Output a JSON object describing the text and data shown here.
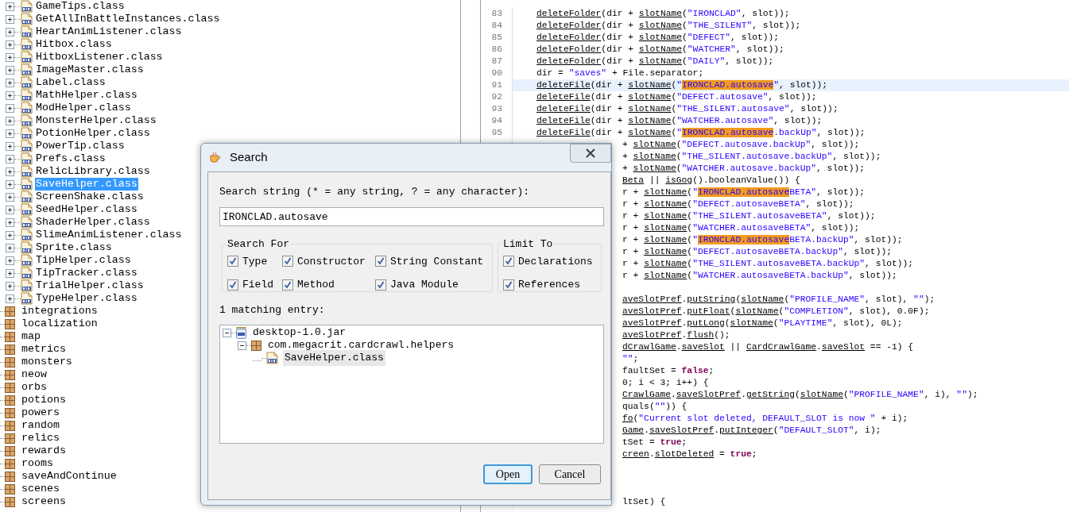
{
  "package_tree": {
    "items": [
      {
        "label": "GameTips.class",
        "kind": "class",
        "selected": false
      },
      {
        "label": "GetAllInBattleInstances.class",
        "kind": "class",
        "selected": false
      },
      {
        "label": "HeartAnimListener.class",
        "kind": "class",
        "selected": false
      },
      {
        "label": "Hitbox.class",
        "kind": "class",
        "selected": false
      },
      {
        "label": "HitboxListener.class",
        "kind": "class",
        "selected": false
      },
      {
        "label": "ImageMaster.class",
        "kind": "class",
        "selected": false
      },
      {
        "label": "Label.class",
        "kind": "class",
        "selected": false
      },
      {
        "label": "MathHelper.class",
        "kind": "class",
        "selected": false
      },
      {
        "label": "ModHelper.class",
        "kind": "class",
        "selected": false
      },
      {
        "label": "MonsterHelper.class",
        "kind": "class",
        "selected": false
      },
      {
        "label": "PotionHelper.class",
        "kind": "class",
        "selected": false
      },
      {
        "label": "PowerTip.class",
        "kind": "class",
        "selected": false
      },
      {
        "label": "Prefs.class",
        "kind": "class",
        "selected": false
      },
      {
        "label": "RelicLibrary.class",
        "kind": "class",
        "selected": false
      },
      {
        "label": "SaveHelper.class",
        "kind": "class",
        "selected": true
      },
      {
        "label": "ScreenShake.class",
        "kind": "class",
        "selected": false
      },
      {
        "label": "SeedHelper.class",
        "kind": "class",
        "selected": false
      },
      {
        "label": "ShaderHelper.class",
        "kind": "class",
        "selected": false
      },
      {
        "label": "SlimeAnimListener.class",
        "kind": "class",
        "selected": false
      },
      {
        "label": "Sprite.class",
        "kind": "class",
        "selected": false
      },
      {
        "label": "TipHelper.class",
        "kind": "class",
        "selected": false
      },
      {
        "label": "TipTracker.class",
        "kind": "class",
        "selected": false
      },
      {
        "label": "TrialHelper.class",
        "kind": "class",
        "selected": false
      },
      {
        "label": "TypeHelper.class",
        "kind": "class",
        "selected": false
      },
      {
        "label": "integrations",
        "kind": "package",
        "selected": false
      },
      {
        "label": "localization",
        "kind": "package",
        "selected": false
      },
      {
        "label": "map",
        "kind": "package",
        "selected": false
      },
      {
        "label": "metrics",
        "kind": "package",
        "selected": false
      },
      {
        "label": "monsters",
        "kind": "package",
        "selected": false
      },
      {
        "label": "neow",
        "kind": "package",
        "selected": false
      },
      {
        "label": "orbs",
        "kind": "package",
        "selected": false
      },
      {
        "label": "potions",
        "kind": "package",
        "selected": false
      },
      {
        "label": "powers",
        "kind": "package",
        "selected": false
      },
      {
        "label": "random",
        "kind": "package",
        "selected": false
      },
      {
        "label": "relics",
        "kind": "package",
        "selected": false
      },
      {
        "label": "rewards",
        "kind": "package",
        "selected": false
      },
      {
        "label": "rooms",
        "kind": "package",
        "selected": false
      },
      {
        "label": "saveAndContinue",
        "kind": "package",
        "selected": false
      },
      {
        "label": "scenes",
        "kind": "package",
        "selected": false
      },
      {
        "label": "screens",
        "kind": "package",
        "selected": false
      }
    ]
  },
  "editor": {
    "lines": [
      {
        "kind": "full",
        "number": "83",
        "current": false,
        "segments": [
          {
            "text": "deleteFolder",
            "kind": "call"
          },
          {
            "text": "(dir + ",
            "kind": "plain"
          },
          {
            "text": "slotName",
            "kind": "call"
          },
          {
            "text": "(",
            "kind": "plain"
          },
          {
            "text": "\"IRONCLAD\"",
            "kind": "string"
          },
          {
            "text": ", slot));",
            "kind": "plain"
          }
        ]
      },
      {
        "kind": "full",
        "number": "84",
        "current": false,
        "segments": [
          {
            "text": "deleteFolder",
            "kind": "call"
          },
          {
            "text": "(dir + ",
            "kind": "plain"
          },
          {
            "text": "slotName",
            "kind": "call"
          },
          {
            "text": "(",
            "kind": "plain"
          },
          {
            "text": "\"THE_SILENT\"",
            "kind": "string"
          },
          {
            "text": ", slot));",
            "kind": "plain"
          }
        ]
      },
      {
        "kind": "full",
        "number": "85",
        "current": false,
        "segments": [
          {
            "text": "deleteFolder",
            "kind": "call"
          },
          {
            "text": "(dir + ",
            "kind": "plain"
          },
          {
            "text": "slotName",
            "kind": "call"
          },
          {
            "text": "(",
            "kind": "plain"
          },
          {
            "text": "\"DEFECT\"",
            "kind": "string"
          },
          {
            "text": ", slot));",
            "kind": "plain"
          }
        ]
      },
      {
        "kind": "full",
        "number": "86",
        "current": false,
        "segments": [
          {
            "text": "deleteFolder",
            "kind": "call"
          },
          {
            "text": "(dir + ",
            "kind": "plain"
          },
          {
            "text": "slotName",
            "kind": "call"
          },
          {
            "text": "(",
            "kind": "plain"
          },
          {
            "text": "\"WATCHER\"",
            "kind": "string"
          },
          {
            "text": ", slot));",
            "kind": "plain"
          }
        ]
      },
      {
        "kind": "full",
        "number": "87",
        "current": false,
        "segments": [
          {
            "text": "deleteFolder",
            "kind": "call"
          },
          {
            "text": "(dir + ",
            "kind": "plain"
          },
          {
            "text": "slotName",
            "kind": "call"
          },
          {
            "text": "(",
            "kind": "plain"
          },
          {
            "text": "\"DAILY\"",
            "kind": "string"
          },
          {
            "text": ", slot));",
            "kind": "plain"
          }
        ]
      },
      {
        "kind": "full",
        "number": "90",
        "current": false,
        "segments": [
          {
            "text": "dir = ",
            "kind": "plain"
          },
          {
            "text": "\"saves\"",
            "kind": "string"
          },
          {
            "text": " + File.separator;",
            "kind": "plain"
          }
        ]
      },
      {
        "kind": "full",
        "number": "91",
        "current": true,
        "segments": [
          {
            "text": "deleteFile",
            "kind": "call"
          },
          {
            "text": "(dir + ",
            "kind": "plain"
          },
          {
            "text": "slotName",
            "kind": "call"
          },
          {
            "text": "(",
            "kind": "plain"
          },
          {
            "text": "\"",
            "kind": "string"
          },
          {
            "text": "IRONCLAD.autosave",
            "kind": "match"
          },
          {
            "text": "\"",
            "kind": "string"
          },
          {
            "text": ", slot));",
            "kind": "plain"
          }
        ]
      },
      {
        "kind": "full",
        "number": "92",
        "current": false,
        "segments": [
          {
            "text": "deleteFile",
            "kind": "call"
          },
          {
            "text": "(dir + ",
            "kind": "plain"
          },
          {
            "text": "slotName",
            "kind": "call"
          },
          {
            "text": "(",
            "kind": "plain"
          },
          {
            "text": "\"DEFECT.autosave\"",
            "kind": "string"
          },
          {
            "text": ", slot));",
            "kind": "plain"
          }
        ]
      },
      {
        "kind": "full",
        "number": "93",
        "current": false,
        "segments": [
          {
            "text": "deleteFile",
            "kind": "call"
          },
          {
            "text": "(dir + ",
            "kind": "plain"
          },
          {
            "text": "slotName",
            "kind": "call"
          },
          {
            "text": "(",
            "kind": "plain"
          },
          {
            "text": "\"THE_SILENT.autosave\"",
            "kind": "string"
          },
          {
            "text": ", slot));",
            "kind": "plain"
          }
        ]
      },
      {
        "kind": "full",
        "number": "94",
        "current": false,
        "segments": [
          {
            "text": "deleteFile",
            "kind": "call"
          },
          {
            "text": "(dir + ",
            "kind": "plain"
          },
          {
            "text": "slotName",
            "kind": "call"
          },
          {
            "text": "(",
            "kind": "plain"
          },
          {
            "text": "\"WATCHER.autosave\"",
            "kind": "string"
          },
          {
            "text": ", slot));",
            "kind": "plain"
          }
        ]
      },
      {
        "kind": "full",
        "number": "95",
        "current": false,
        "segments": [
          {
            "text": "deleteFile",
            "kind": "call"
          },
          {
            "text": "(dir + ",
            "kind": "plain"
          },
          {
            "text": "slotName",
            "kind": "call"
          },
          {
            "text": "(",
            "kind": "plain"
          },
          {
            "text": "\"",
            "kind": "string"
          },
          {
            "text": "IRONCLAD.autosave",
            "kind": "match"
          },
          {
            "text": ".backUp\"",
            "kind": "string"
          },
          {
            "text": ", slot));",
            "kind": "plain"
          }
        ]
      },
      {
        "kind": "partial",
        "current": false,
        "segments": [
          {
            "text": "+ ",
            "kind": "plain"
          },
          {
            "text": "slotName",
            "kind": "call"
          },
          {
            "text": "(",
            "kind": "plain"
          },
          {
            "text": "\"DEFECT.autosave.backUp\"",
            "kind": "string"
          },
          {
            "text": ", slot));",
            "kind": "plain"
          }
        ]
      },
      {
        "kind": "partial",
        "current": false,
        "segments": [
          {
            "text": "+ ",
            "kind": "plain"
          },
          {
            "text": "slotName",
            "kind": "call"
          },
          {
            "text": "(",
            "kind": "plain"
          },
          {
            "text": "\"THE_SILENT.autosave.backUp\"",
            "kind": "string"
          },
          {
            "text": ", slot));",
            "kind": "plain"
          }
        ]
      },
      {
        "kind": "partial",
        "current": false,
        "segments": [
          {
            "text": "+ ",
            "kind": "plain"
          },
          {
            "text": "slotName",
            "kind": "call"
          },
          {
            "text": "(",
            "kind": "plain"
          },
          {
            "text": "\"WATCHER.autosave.backUp\"",
            "kind": "string"
          },
          {
            "text": ", slot));",
            "kind": "plain"
          }
        ]
      },
      {
        "kind": "partial",
        "current": false,
        "segments": [
          {
            "text": "Beta",
            "kind": "call"
          },
          {
            "text": " || ",
            "kind": "plain"
          },
          {
            "text": "isGog",
            "kind": "call"
          },
          {
            "text": "().booleanValue()) {",
            "kind": "plain"
          }
        ]
      },
      {
        "kind": "partial",
        "current": false,
        "segments": [
          {
            "text": "r + ",
            "kind": "plain"
          },
          {
            "text": "slotName",
            "kind": "call"
          },
          {
            "text": "(",
            "kind": "plain"
          },
          {
            "text": "\"",
            "kind": "string"
          },
          {
            "text": "IRONCLAD.autosave",
            "kind": "match"
          },
          {
            "text": "BETA\"",
            "kind": "string"
          },
          {
            "text": ", slot));",
            "kind": "plain"
          }
        ]
      },
      {
        "kind": "partial",
        "current": false,
        "segments": [
          {
            "text": "r + ",
            "kind": "plain"
          },
          {
            "text": "slotName",
            "kind": "call"
          },
          {
            "text": "(",
            "kind": "plain"
          },
          {
            "text": "\"DEFECT.autosaveBETA\"",
            "kind": "string"
          },
          {
            "text": ", slot));",
            "kind": "plain"
          }
        ]
      },
      {
        "kind": "partial",
        "current": false,
        "segments": [
          {
            "text": "r + ",
            "kind": "plain"
          },
          {
            "text": "slotName",
            "kind": "call"
          },
          {
            "text": "(",
            "kind": "plain"
          },
          {
            "text": "\"THE_SILENT.autosaveBETA\"",
            "kind": "string"
          },
          {
            "text": ", slot));",
            "kind": "plain"
          }
        ]
      },
      {
        "kind": "partial",
        "current": false,
        "segments": [
          {
            "text": "r + ",
            "kind": "plain"
          },
          {
            "text": "slotName",
            "kind": "call"
          },
          {
            "text": "(",
            "kind": "plain"
          },
          {
            "text": "\"WATCHER.autosaveBETA\"",
            "kind": "string"
          },
          {
            "text": ", slot));",
            "kind": "plain"
          }
        ]
      },
      {
        "kind": "partial",
        "current": false,
        "segments": [
          {
            "text": "r + ",
            "kind": "plain"
          },
          {
            "text": "slotName",
            "kind": "call"
          },
          {
            "text": "(",
            "kind": "plain"
          },
          {
            "text": "\"",
            "kind": "string"
          },
          {
            "text": "IRONCLAD.autosave",
            "kind": "match"
          },
          {
            "text": "BETA.backUp\"",
            "kind": "string"
          },
          {
            "text": ", slot));",
            "kind": "plain"
          }
        ]
      },
      {
        "kind": "partial",
        "current": false,
        "segments": [
          {
            "text": "r + ",
            "kind": "plain"
          },
          {
            "text": "slotName",
            "kind": "call"
          },
          {
            "text": "(",
            "kind": "plain"
          },
          {
            "text": "\"DEFECT.autosaveBETA.backUp\"",
            "kind": "string"
          },
          {
            "text": ", slot));",
            "kind": "plain"
          }
        ]
      },
      {
        "kind": "partial",
        "current": false,
        "segments": [
          {
            "text": "r + ",
            "kind": "plain"
          },
          {
            "text": "slotName",
            "kind": "call"
          },
          {
            "text": "(",
            "kind": "plain"
          },
          {
            "text": "\"THE_SILENT.autosaveBETA.backUp\"",
            "kind": "string"
          },
          {
            "text": ", slot));",
            "kind": "plain"
          }
        ]
      },
      {
        "kind": "partial",
        "current": false,
        "segments": [
          {
            "text": "r + ",
            "kind": "plain"
          },
          {
            "text": "slotName",
            "kind": "call"
          },
          {
            "text": "(",
            "kind": "plain"
          },
          {
            "text": "\"WATCHER.autosaveBETA.backUp\"",
            "kind": "string"
          },
          {
            "text": ", slot));",
            "kind": "plain"
          }
        ]
      },
      {
        "kind": "blank",
        "current": false
      },
      {
        "kind": "partial",
        "current": false,
        "segments": [
          {
            "text": "aveSlotPref",
            "kind": "call"
          },
          {
            "text": ".",
            "kind": "plain"
          },
          {
            "text": "putString",
            "kind": "call"
          },
          {
            "text": "(",
            "kind": "plain"
          },
          {
            "text": "slotName",
            "kind": "call"
          },
          {
            "text": "(",
            "kind": "plain"
          },
          {
            "text": "\"PROFILE_NAME\"",
            "kind": "string"
          },
          {
            "text": ", slot), ",
            "kind": "plain"
          },
          {
            "text": "\"\"",
            "kind": "string"
          },
          {
            "text": ");",
            "kind": "plain"
          }
        ]
      },
      {
        "kind": "partial",
        "current": false,
        "segments": [
          {
            "text": "aveSlotPref",
            "kind": "call"
          },
          {
            "text": ".",
            "kind": "plain"
          },
          {
            "text": "putFloat",
            "kind": "call"
          },
          {
            "text": "(",
            "kind": "plain"
          },
          {
            "text": "slotName",
            "kind": "call"
          },
          {
            "text": "(",
            "kind": "plain"
          },
          {
            "text": "\"COMPLETION\"",
            "kind": "string"
          },
          {
            "text": ", slot), 0.0F);",
            "kind": "plain"
          }
        ]
      },
      {
        "kind": "partial",
        "current": false,
        "segments": [
          {
            "text": "aveSlotPref",
            "kind": "call"
          },
          {
            "text": ".",
            "kind": "plain"
          },
          {
            "text": "putLong",
            "kind": "call"
          },
          {
            "text": "(",
            "kind": "plain"
          },
          {
            "text": "slotName",
            "kind": "call"
          },
          {
            "text": "(",
            "kind": "plain"
          },
          {
            "text": "\"PLAYTIME\"",
            "kind": "string"
          },
          {
            "text": ", slot), 0L);",
            "kind": "plain"
          }
        ]
      },
      {
        "kind": "partial",
        "current": false,
        "segments": [
          {
            "text": "aveSlotPref",
            "kind": "call"
          },
          {
            "text": ".",
            "kind": "plain"
          },
          {
            "text": "flush",
            "kind": "call"
          },
          {
            "text": "();",
            "kind": "plain"
          }
        ]
      },
      {
        "kind": "partial",
        "current": false,
        "segments": [
          {
            "text": "dCrawlGame",
            "kind": "call"
          },
          {
            "text": ".",
            "kind": "plain"
          },
          {
            "text": "saveSlot",
            "kind": "call"
          },
          {
            "text": " || ",
            "kind": "plain"
          },
          {
            "text": "CardCrawlGame",
            "kind": "call"
          },
          {
            "text": ".",
            "kind": "plain"
          },
          {
            "text": "saveSlot",
            "kind": "call"
          },
          {
            "text": " == -1) {",
            "kind": "plain"
          }
        ]
      },
      {
        "kind": "partial",
        "current": false,
        "segments": [
          {
            "text": "\"\"",
            "kind": "string"
          },
          {
            "text": ";",
            "kind": "plain"
          }
        ]
      },
      {
        "kind": "partial",
        "current": false,
        "segments": [
          {
            "text": "faultSet = ",
            "kind": "plain"
          },
          {
            "text": "false",
            "kind": "keyword"
          },
          {
            "text": ";",
            "kind": "plain"
          }
        ]
      },
      {
        "kind": "partial",
        "current": false,
        "segments": [
          {
            "text": "0; i < 3; i++) {",
            "kind": "plain"
          }
        ]
      },
      {
        "kind": "partial",
        "current": false,
        "segments": [
          {
            "text": "CrawlGame",
            "kind": "call"
          },
          {
            "text": ".",
            "kind": "plain"
          },
          {
            "text": "saveSlotPref",
            "kind": "call"
          },
          {
            "text": ".",
            "kind": "plain"
          },
          {
            "text": "getString",
            "kind": "call"
          },
          {
            "text": "(",
            "kind": "plain"
          },
          {
            "text": "slotName",
            "kind": "call"
          },
          {
            "text": "(",
            "kind": "plain"
          },
          {
            "text": "\"PROFILE_NAME\"",
            "kind": "string"
          },
          {
            "text": ", i), ",
            "kind": "plain"
          },
          {
            "text": "\"\"",
            "kind": "string"
          },
          {
            "text": ");",
            "kind": "plain"
          }
        ]
      },
      {
        "kind": "partial",
        "current": false,
        "segments": [
          {
            "text": "quals(",
            "kind": "plain"
          },
          {
            "text": "\"\"",
            "kind": "string"
          },
          {
            "text": ")) {",
            "kind": "plain"
          }
        ]
      },
      {
        "kind": "partial",
        "current": false,
        "segments": [
          {
            "text": "fo",
            "kind": "call"
          },
          {
            "text": "(",
            "kind": "plain"
          },
          {
            "text": "\"Current slot deleted, DEFAULT_SLOT is now \"",
            "kind": "string"
          },
          {
            "text": " + i);",
            "kind": "plain"
          }
        ]
      },
      {
        "kind": "partial",
        "current": false,
        "segments": [
          {
            "text": "Game",
            "kind": "call"
          },
          {
            "text": ".",
            "kind": "plain"
          },
          {
            "text": "saveSlotPref",
            "kind": "call"
          },
          {
            "text": ".",
            "kind": "plain"
          },
          {
            "text": "putInteger",
            "kind": "call"
          },
          {
            "text": "(",
            "kind": "plain"
          },
          {
            "text": "\"DEFAULT_SLOT\"",
            "kind": "string"
          },
          {
            "text": ", i);",
            "kind": "plain"
          }
        ]
      },
      {
        "kind": "partial",
        "current": false,
        "segments": [
          {
            "text": "tSet = ",
            "kind": "plain"
          },
          {
            "text": "true",
            "kind": "keyword"
          },
          {
            "text": ";",
            "kind": "plain"
          }
        ]
      },
      {
        "kind": "partial",
        "current": false,
        "segments": [
          {
            "text": "creen",
            "kind": "call"
          },
          {
            "text": ".",
            "kind": "plain"
          },
          {
            "text": "slotDeleted",
            "kind": "call"
          },
          {
            "text": " = ",
            "kind": "plain"
          },
          {
            "text": "true",
            "kind": "keyword"
          },
          {
            "text": ";",
            "kind": "plain"
          }
        ]
      },
      {
        "kind": "blank",
        "current": false
      },
      {
        "kind": "blank",
        "current": false
      },
      {
        "kind": "blank",
        "current": false
      },
      {
        "kind": "partial",
        "current": false,
        "segments": [
          {
            "text": "ltSet) {",
            "kind": "plain"
          }
        ]
      }
    ]
  },
  "search_dialog": {
    "title": "Search",
    "search_label": "Search string (* = any string, ? = any character):",
    "search_value": "IRONCLAD.autosave",
    "search_for": {
      "title": "Search For",
      "options": [
        {
          "label": "Type",
          "checked": true
        },
        {
          "label": "Constructor",
          "checked": true
        },
        {
          "label": "String Constant",
          "checked": true
        },
        {
          "label": "Field",
          "checked": true
        },
        {
          "label": "Method",
          "checked": true
        },
        {
          "label": "Java Module",
          "checked": true
        }
      ]
    },
    "limit_to": {
      "title": "Limit To",
      "options": [
        {
          "label": "Declarations",
          "checked": true
        },
        {
          "label": "References",
          "checked": true
        }
      ]
    },
    "result_label": "1 matching entry:",
    "results": [
      {
        "label": "desktop-1.0.jar",
        "kind": "jar",
        "selected": false,
        "children": [
          {
            "label": "com.megacrit.cardcrawl.helpers",
            "kind": "package",
            "selected": false,
            "children": [
              {
                "label": "SaveHelper.class",
                "kind": "class",
                "selected": true
              }
            ]
          }
        ]
      }
    ],
    "buttons": [
      {
        "label": "Open",
        "default": true
      },
      {
        "label": "Cancel",
        "default": false
      }
    ]
  }
}
